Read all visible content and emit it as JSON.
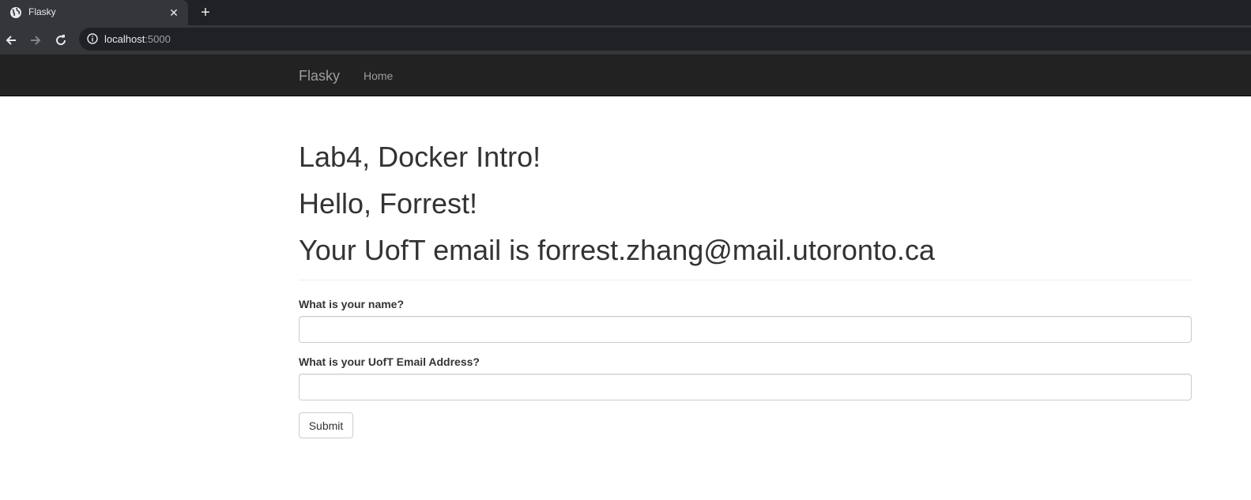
{
  "browser": {
    "tab_title": "Flasky",
    "url_host": "localhost",
    "url_port": ":5000"
  },
  "navbar": {
    "brand": "Flasky",
    "home": "Home"
  },
  "main": {
    "heading": "Lab4, Docker Intro!",
    "greeting": "Hello, Forrest!",
    "email_line": "Your UofT email is forrest.zhang@mail.utoronto.ca"
  },
  "form": {
    "name_label": "What is your name?",
    "name_value": "",
    "email_label": "What is your UofT Email Address?",
    "email_value": "",
    "submit_label": "Submit"
  },
  "colors": {
    "navbar_bg": "#222222",
    "navbar_text": "#9d9d9d",
    "chrome_dark": "#202124",
    "chrome_mid": "#35363a"
  }
}
